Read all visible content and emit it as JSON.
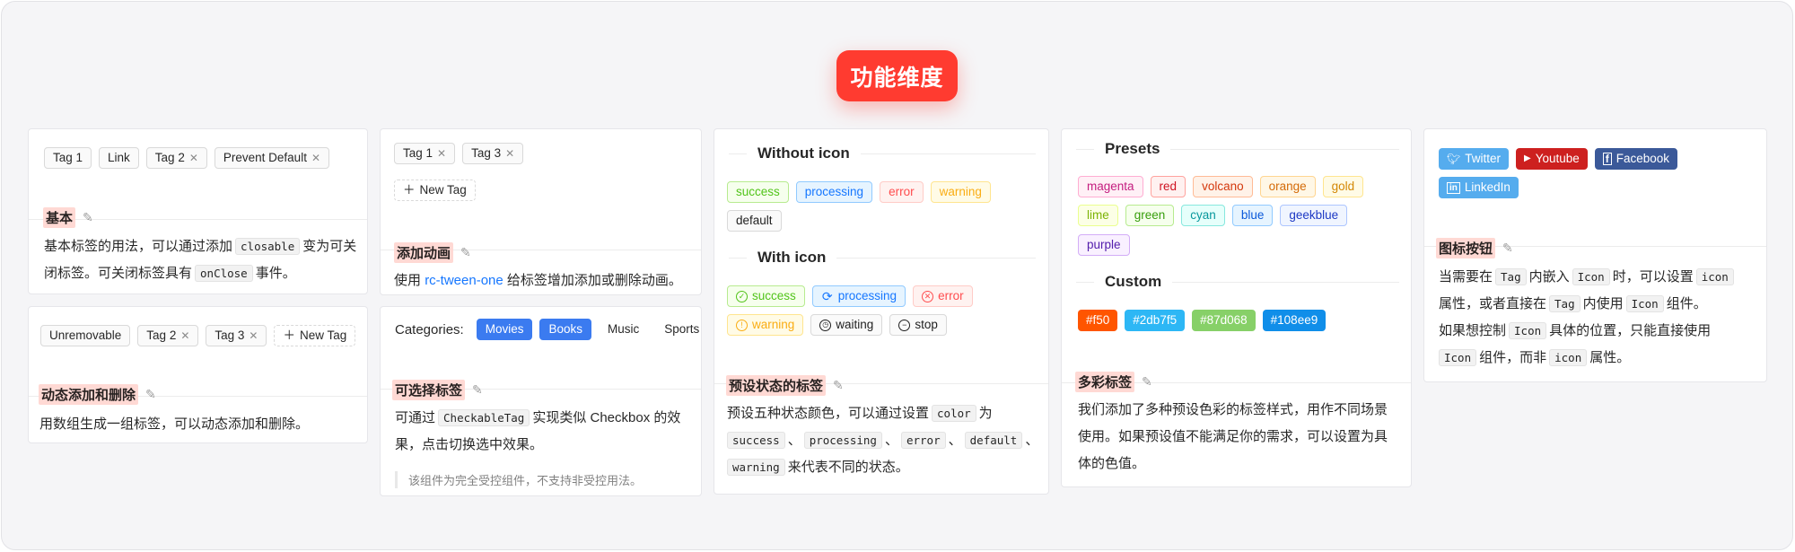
{
  "hero": {
    "title": "功能维度"
  },
  "c1": {
    "tags": [
      {
        "label": "Tag 1",
        "closable": false
      },
      {
        "label": "Link",
        "closable": false
      },
      {
        "label": "Tag 2",
        "closable": true
      },
      {
        "label": "Prevent Default",
        "closable": true
      }
    ],
    "title": "基本",
    "desc": {
      "a": "基本标签的用法，可以通过添加",
      "code1": "closable",
      "b": "变为可关",
      "c": "闭标签。可关闭标签具有",
      "code2": "onClose",
      "d": "事件。"
    }
  },
  "c2": {
    "tags": [
      {
        "label": "Unremovable",
        "closable": false
      },
      {
        "label": "Tag 2",
        "closable": true
      },
      {
        "label": "Tag 3",
        "closable": true
      }
    ],
    "new_tag": "New Tag",
    "title": "动态添加和删除",
    "desc": "用数组生成一组标签，可以动态添加和删除。"
  },
  "c3": {
    "tags": [
      {
        "label": "Tag 1"
      },
      {
        "label": "Tag 3"
      }
    ],
    "new_tag": "New Tag",
    "title": "添加动画",
    "desc": {
      "a": "使用",
      "link": "rc-tween-one",
      "b": "给标签增加添加或删除动画。"
    }
  },
  "c4": {
    "label": "Categories:",
    "options": [
      {
        "label": "Movies",
        "checked": true
      },
      {
        "label": "Books",
        "checked": true
      },
      {
        "label": "Music",
        "checked": false
      },
      {
        "label": "Sports",
        "checked": false
      }
    ],
    "title": "可选择标签",
    "desc": {
      "a": "可通过",
      "code": "CheckableTag",
      "b": "实现类似 Checkbox 的效",
      "c": "果，点击切换选中效果。"
    },
    "note": "该组件为完全受控组件，不支持非受控用法。"
  },
  "c5": {
    "divider1": "Without icon",
    "divider2": "With icon",
    "status_tags": [
      {
        "label": "success",
        "color": "#52c41a",
        "bg": "#f6ffed",
        "border": "#b7eb8f"
      },
      {
        "label": "processing",
        "color": "#1677ff",
        "bg": "#e6f4ff",
        "border": "#91caff"
      },
      {
        "label": "error",
        "color": "#ff4d4f",
        "bg": "#fff2f0",
        "border": "#ffccc7"
      },
      {
        "label": "warning",
        "color": "#faad14",
        "bg": "#fffbe6",
        "border": "#ffe58f"
      },
      {
        "label": "default",
        "color": "rgba(0,0,0,0.88)",
        "bg": "#fafafa",
        "border": "#d9d9d9"
      }
    ],
    "icon_tags": [
      {
        "label": "success",
        "icon": "check-circle-icon",
        "color": "#52c41a",
        "bg": "#f6ffed",
        "border": "#b7eb8f"
      },
      {
        "label": "processing",
        "icon": "sync-icon",
        "color": "#1677ff",
        "bg": "#e6f4ff",
        "border": "#91caff"
      },
      {
        "label": "error",
        "icon": "close-circle-icon",
        "color": "#ff4d4f",
        "bg": "#fff2f0",
        "border": "#ffccc7"
      },
      {
        "label": "warning",
        "icon": "exclamation-circle-icon",
        "color": "#faad14",
        "bg": "#fffbe6",
        "border": "#ffe58f"
      },
      {
        "label": "waiting",
        "icon": "clock-circle-icon",
        "color": "rgba(0,0,0,0.88)",
        "bg": "#fafafa",
        "border": "#d9d9d9"
      },
      {
        "label": "stop",
        "icon": "minus-circle-icon",
        "color": "rgba(0,0,0,0.88)",
        "bg": "#fafafa",
        "border": "#d9d9d9"
      }
    ],
    "title": "预设状态的标签",
    "desc": {
      "a": "预设五种状态颜色，可以通过设置",
      "code1": "color",
      "b": "为",
      "code2": "success",
      "code3": "processing",
      "code4": "error",
      "code5": "default",
      "code6": "warning",
      "sep": "、",
      "c": "来代表不同的状态。"
    }
  },
  "c6": {
    "divider1": "Presets",
    "divider2": "Custom",
    "presets": [
      {
        "label": "magenta",
        "color": "#c41d7f",
        "bg": "#fff0f6",
        "border": "#ffadd2"
      },
      {
        "label": "red",
        "color": "#cf1322",
        "bg": "#fff1f0",
        "border": "#ffa39e"
      },
      {
        "label": "volcano",
        "color": "#d4380d",
        "bg": "#fff2e8",
        "border": "#ffbb96"
      },
      {
        "label": "orange",
        "color": "#d46b08",
        "bg": "#fff7e6",
        "border": "#ffd591"
      },
      {
        "label": "gold",
        "color": "#d48806",
        "bg": "#fffbe6",
        "border": "#ffe58f"
      },
      {
        "label": "lime",
        "color": "#7cb305",
        "bg": "#fcffe6",
        "border": "#eaff8f"
      },
      {
        "label": "green",
        "color": "#389e0d",
        "bg": "#f6ffed",
        "border": "#b7eb8f"
      },
      {
        "label": "cyan",
        "color": "#08979c",
        "bg": "#e6fffb",
        "border": "#87e8de"
      },
      {
        "label": "blue",
        "color": "#0958d9",
        "bg": "#e6f4ff",
        "border": "#91caff"
      },
      {
        "label": "geekblue",
        "color": "#1d39c4",
        "bg": "#f0f5ff",
        "border": "#adc6ff"
      },
      {
        "label": "purple",
        "color": "#531dab",
        "bg": "#f9f0ff",
        "border": "#d3adf7"
      }
    ],
    "custom": [
      {
        "label": "#f50",
        "bg": "#ff5500"
      },
      {
        "label": "#2db7f5",
        "bg": "#2db7f5"
      },
      {
        "label": "#87d068",
        "bg": "#87d068"
      },
      {
        "label": "#108ee9",
        "bg": "#108ee9"
      }
    ],
    "title": "多彩标签",
    "desc": {
      "a": "我们添加了多种预设色彩的标签样式，用作不同场景",
      "b": "使用。如果预设值不能满足你的需求，可以设置为具",
      "c": "体的色值。"
    }
  },
  "c7": {
    "social": [
      {
        "label": "Twitter",
        "icon": "twitter-icon",
        "bg": "#55acee"
      },
      {
        "label": "Youtube",
        "icon": "youtube-icon",
        "bg": "#cd201f"
      },
      {
        "label": "Facebook",
        "icon": "facebook-icon",
        "bg": "#3b5999"
      },
      {
        "label": "LinkedIn",
        "icon": "linkedin-icon",
        "bg": "#55acee"
      }
    ],
    "title": "图标按钮",
    "desc": {
      "a": "当需要在",
      "code1": "Tag",
      "b": "内嵌入",
      "code2": "Icon",
      "c": "时，可以设置",
      "code3": "icon",
      "d": "属性，或者直接在",
      "code4": "Tag",
      "e": "内使用",
      "code5": "Icon",
      "f": "组件。",
      "g": "如果想控制",
      "code6": "Icon",
      "h": "具体的位置，只能直接使用",
      "code7": "Icon",
      "i": "组件，而非",
      "code8": "icon",
      "j": "属性。"
    }
  },
  "icons": {
    "edit": "edit-icon",
    "close": "close-icon",
    "plus": "plus-icon"
  }
}
